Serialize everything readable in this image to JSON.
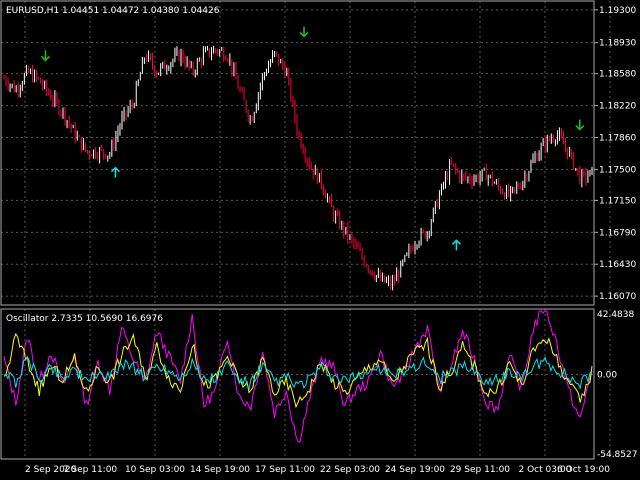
{
  "chart_data": [
    {
      "type": "candlestick",
      "title": "EURUSD,H1  1.04451 1.04472 1.04380 1.04426",
      "ylim": [
        1.1597,
        1.194
      ],
      "y_ticks": [
        "1.19300",
        "1.18930",
        "1.18580",
        "1.18220",
        "1.17860",
        "1.17500",
        "1.17150",
        "1.16790",
        "1.16430",
        "1.16070"
      ],
      "x_ticks": [
        "2 Sep 2020",
        "7 Sep 11:00",
        "10 Sep 03:00",
        "14 Sep 19:00",
        "17 Sep 11:00",
        "22 Sep 03:00",
        "24 Sep 19:00",
        "29 Sep 11:00",
        "2 Oct 03:00",
        "6 Oct 19:00"
      ],
      "price_path_x_fraction": [
        0,
        0.02,
        0.04,
        0.06,
        0.08,
        0.1,
        0.12,
        0.14,
        0.16,
        0.18,
        0.2,
        0.22,
        0.24,
        0.26,
        0.28,
        0.3,
        0.32,
        0.34,
        0.36,
        0.38,
        0.4,
        0.42,
        0.44,
        0.46,
        0.48,
        0.5,
        0.52,
        0.54,
        0.56,
        0.58,
        0.6,
        0.62,
        0.64,
        0.66,
        0.68,
        0.7,
        0.72,
        0.74,
        0.76,
        0.78,
        0.8,
        0.82,
        0.84,
        0.86,
        0.88,
        0.9,
        0.92,
        0.94,
        0.96,
        0.98,
        1.0
      ],
      "price_path": [
        1.1853,
        1.184,
        1.186,
        1.185,
        1.1832,
        1.1815,
        1.179,
        1.177,
        1.177,
        1.1768,
        1.1805,
        1.1825,
        1.188,
        1.186,
        1.187,
        1.188,
        1.186,
        1.188,
        1.1885,
        1.188,
        1.184,
        1.1805,
        1.1855,
        1.188,
        1.186,
        1.179,
        1.1755,
        1.1735,
        1.17,
        1.168,
        1.166,
        1.164,
        1.1625,
        1.162,
        1.1645,
        1.167,
        1.168,
        1.172,
        1.1755,
        1.174,
        1.174,
        1.1745,
        1.173,
        1.172,
        1.1735,
        1.176,
        1.178,
        1.179,
        1.177,
        1.174,
        1.1745
      ],
      "signals": [
        {
          "type": "sell",
          "x_fraction": 0.075,
          "price": 1.1873
        },
        {
          "type": "buy",
          "x_fraction": 0.193,
          "price": 1.1752
        },
        {
          "type": "sell",
          "x_fraction": 0.511,
          "price": 1.19
        },
        {
          "type": "buy",
          "x_fraction": 0.768,
          "price": 1.167
        },
        {
          "type": "sell",
          "x_fraction": 0.976,
          "price": 1.1795
        }
      ]
    },
    {
      "type": "line",
      "title": "Oscillator 2.7335 10.5690 16.6976",
      "ylim": [
        -54.8527,
        42.4838
      ],
      "y_ticks": [
        "42.4838",
        "0.00",
        "-54.8527"
      ],
      "series": [
        {
          "color": "#ff00ff",
          "values": [
            10,
            -18,
            25,
            -5,
            15,
            -8,
            12,
            -20,
            8,
            -10,
            30,
            10,
            -5,
            28,
            12,
            -4,
            38,
            -20,
            -10,
            25,
            -15,
            -20,
            15,
            -25,
            -10,
            -45,
            -15,
            10,
            5,
            -20,
            -10,
            -5,
            15,
            -8,
            0,
            18,
            30,
            -10,
            5,
            28,
            10,
            -18,
            -22,
            12,
            -10,
            30,
            45,
            20,
            -10,
            -30,
            5
          ]
        },
        {
          "color": "#ffff00",
          "values": [
            -5,
            25,
            8,
            -10,
            5,
            -3,
            10,
            -12,
            5,
            -5,
            12,
            25,
            -3,
            18,
            -2,
            -10,
            20,
            -8,
            -3,
            12,
            -5,
            -10,
            10,
            -12,
            -5,
            -20,
            -8,
            8,
            -5,
            -12,
            -3,
            5,
            10,
            -6,
            5,
            15,
            20,
            -8,
            2,
            18,
            5,
            -12,
            -10,
            8,
            -8,
            15,
            25,
            10,
            -5,
            -18,
            2
          ]
        },
        {
          "color": "#00e5ee",
          "values": [
            2,
            -5,
            10,
            -3,
            5,
            -2,
            4,
            -6,
            2,
            -3,
            8,
            5,
            -2,
            6,
            3,
            -2,
            8,
            -4,
            -2,
            6,
            -4,
            -6,
            5,
            -5,
            -2,
            -8,
            -3,
            4,
            -2,
            -5,
            -1,
            2,
            4,
            -2,
            3,
            6,
            8,
            -3,
            1,
            6,
            3,
            -5,
            -4,
            3,
            -3,
            5,
            8,
            4,
            -2,
            -6,
            1
          ]
        }
      ]
    }
  ],
  "colors": {
    "bull": "#ffffff",
    "bear": "#ff0040",
    "grid": "#5a5a5a",
    "sell_arrow": "#20c020",
    "buy_arrow": "#00e5ee"
  }
}
